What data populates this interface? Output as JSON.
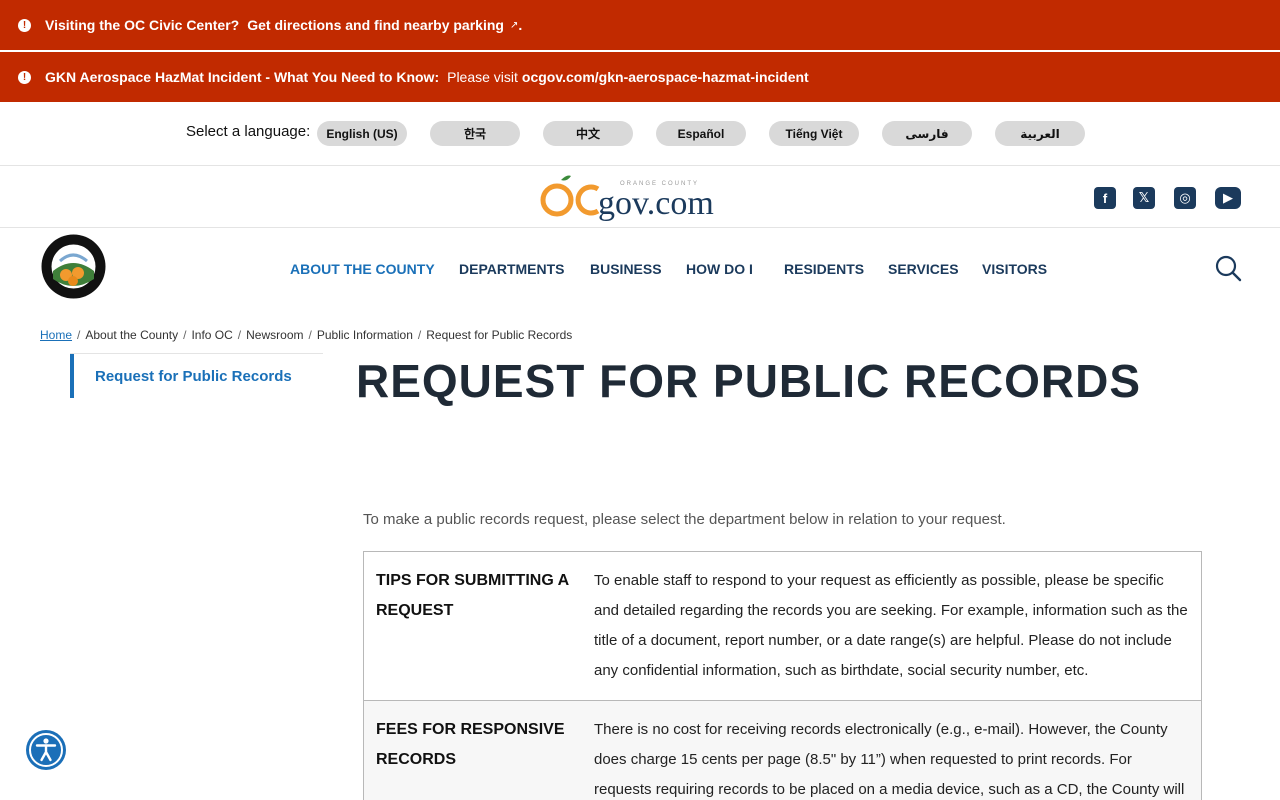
{
  "alerts": [
    {
      "lead": "Visiting the OC Civic Center?",
      "link": "Get directions and find nearby parking",
      "tail": "."
    },
    {
      "lead": "GKN Aerospace HazMat Incident - What You Need to Know:",
      "plain": "Please visit",
      "link": "ocgov.com/gkn-aerospace-hazmat-incident"
    }
  ],
  "language": {
    "label": "Select a language:",
    "options": [
      "English (US)",
      "한국",
      "中文",
      "Español",
      "Tiếng Việt",
      "فارسی",
      "العربية"
    ]
  },
  "brand": {
    "logo_text": "gov.com",
    "logo_prefix": "OC",
    "logo_tagline": "ORANGE COUNTY"
  },
  "seal": {
    "top": "COUNTY of ORANGE",
    "bottom": "CALIFORNIA"
  },
  "nav": {
    "items": [
      "ABOUT THE COUNTY",
      "DEPARTMENTS",
      "BUSINESS",
      "HOW DO I",
      "RESIDENTS",
      "SERVICES",
      "VISITORS"
    ]
  },
  "breadcrumbs": [
    "Home",
    "About the County",
    "Info OC",
    "Newsroom",
    "Public Information",
    "Request for Public Records"
  ],
  "sidebar": {
    "items": [
      "Request for Public Records"
    ]
  },
  "page": {
    "title": "REQUEST FOR PUBLIC RECORDS",
    "intro": "To make a public records request, please select the department below in relation to your request."
  },
  "table": [
    {
      "header": "TIPS FOR SUBMITTING A REQUEST",
      "body": "To enable staff to respond to your request as efficiently as possible, please be specific and detailed regarding the records you are seeking. For example, information such as the title of a document, report number, or a date range(s) are helpful. Please do not include any confidential information, such as birthdate, social security number, etc."
    },
    {
      "header": "FEES FOR RESPONSIVE RECORDS",
      "body": "There is no cost for receiving records electronically (e.g., e-mail). However, the County does charge 15 cents per page (8.5\" by 11”) when requested to print records. For requests requiring records to be placed on a media device, such as a CD, the County will"
    }
  ],
  "colors": {
    "alert": "#c12a00",
    "nav": "#1b3a5c",
    "accent": "#1a70b8",
    "logo_orange": "#f29a2e"
  }
}
